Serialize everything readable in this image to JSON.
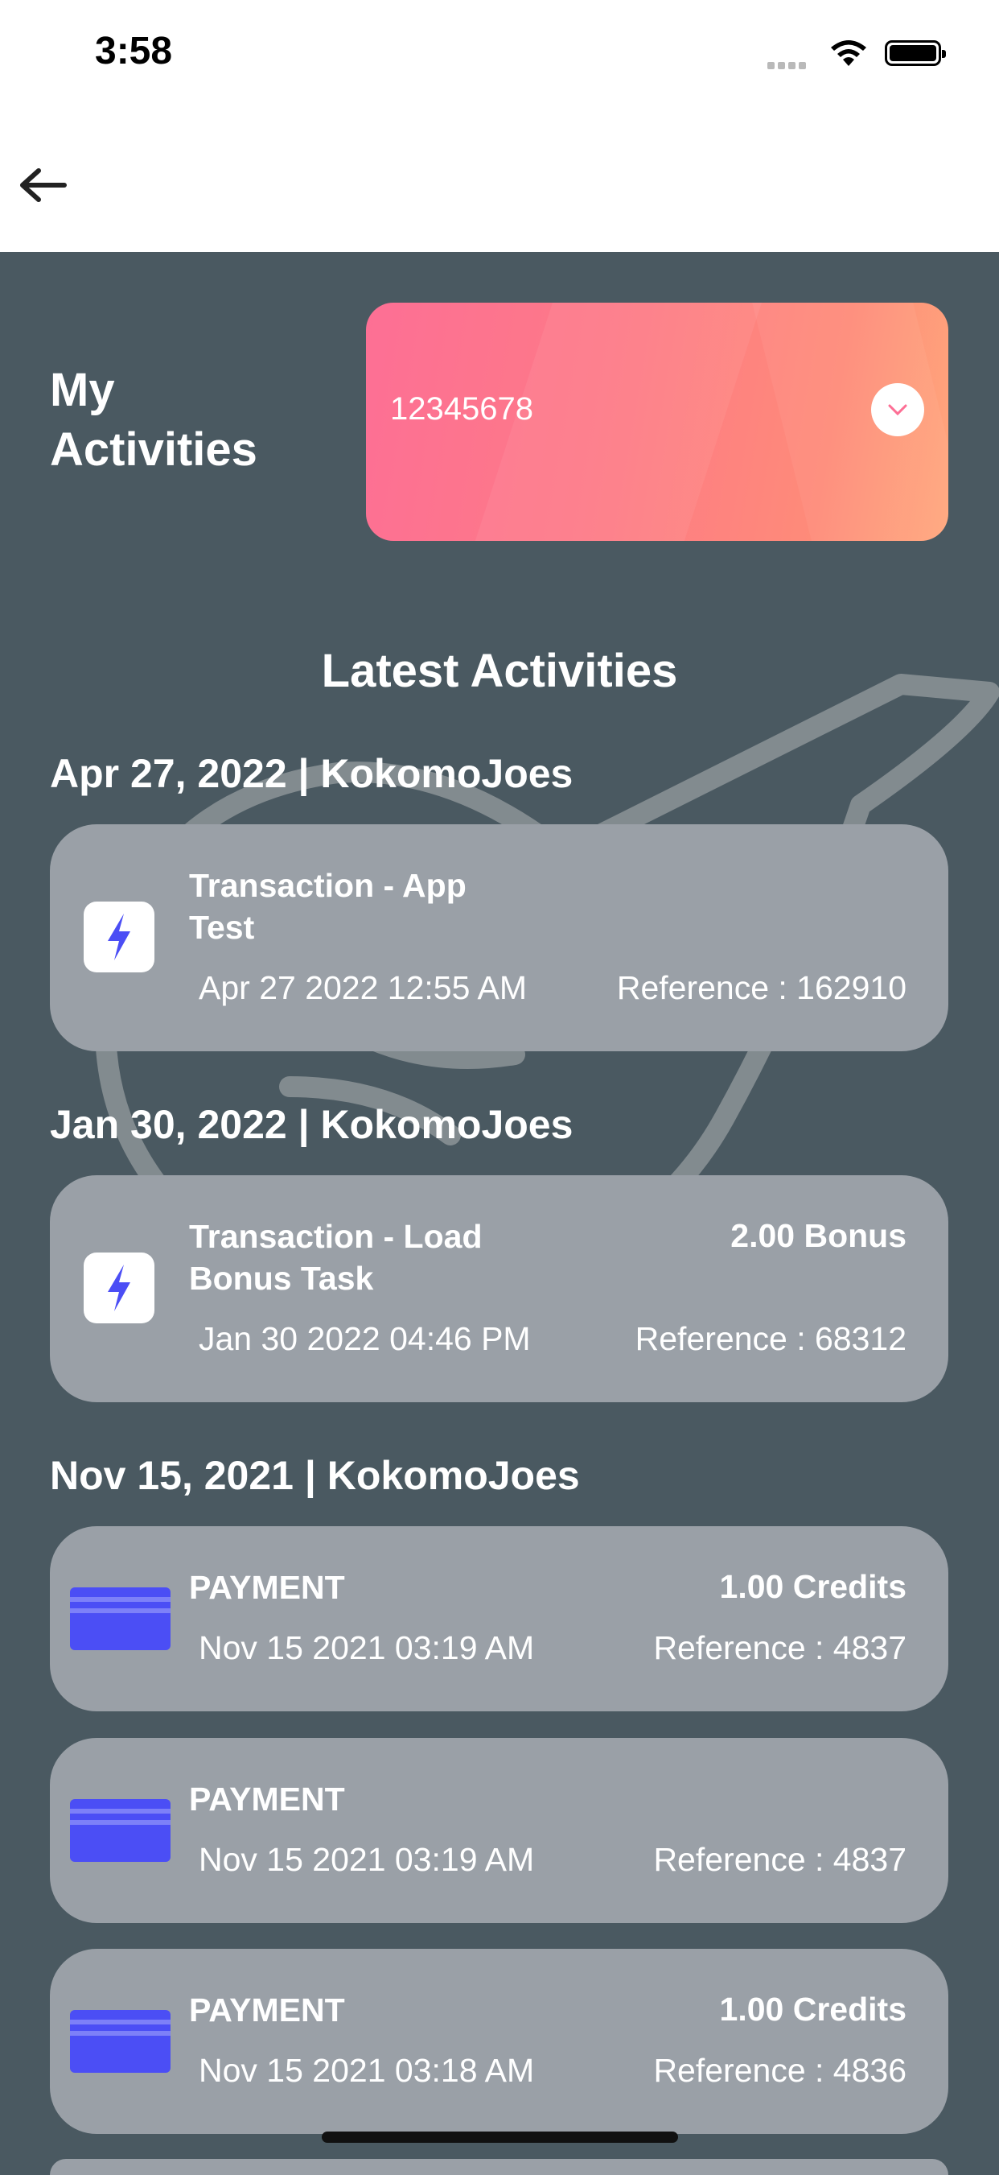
{
  "status_bar": {
    "time": "3:58",
    "signal_icon": "signal-dots-icon",
    "wifi_icon": "wifi-icon",
    "battery_icon": "battery-icon"
  },
  "nav": {
    "back_icon": "arrow-left-icon"
  },
  "header": {
    "title_line1": "My",
    "title_line2": "Activities"
  },
  "account_selector": {
    "number": "12345678",
    "dropdown_icon": "chevron-down-icon",
    "gradient_colors": [
      "#fd6f95",
      "#ffa77c"
    ]
  },
  "section_title": "Latest Activities",
  "groups": [
    {
      "header": "Apr 27, 2022 | KokomoJoes",
      "items": [
        {
          "icon": "lightning-bolt-icon",
          "title_line1": "Transaction - App",
          "title_line2": "Test",
          "amount": "",
          "time": "Apr 27 2022 12:55 AM",
          "reference": "Reference : 162910"
        }
      ]
    },
    {
      "header": "Jan 30, 2022 | KokomoJoes",
      "items": [
        {
          "icon": "lightning-bolt-icon",
          "title_line1": "Transaction - Load",
          "title_line2": "Bonus Task",
          "amount": "2.00 Bonus",
          "time": "Jan 30 2022 04:46 PM",
          "reference": "Reference : 68312"
        }
      ]
    },
    {
      "header": "Nov 15, 2021 | KokomoJoes",
      "items": [
        {
          "icon": "payment-card-icon",
          "title_line1": "PAYMENT",
          "amount": "1.00 Credits",
          "time": "Nov 15 2021 03:19 AM",
          "reference": "Reference : 4837"
        },
        {
          "icon": "payment-card-icon",
          "title_line1": "PAYMENT",
          "amount": "",
          "time": "Nov 15 2021 03:19 AM",
          "reference": "Reference : 4837"
        },
        {
          "icon": "payment-card-icon",
          "title_line1": "PAYMENT",
          "amount": "1.00 Credits",
          "time": "Nov 15 2021 03:18 AM",
          "reference": "Reference : 4836"
        }
      ]
    }
  ],
  "colors": {
    "background": "#4a5961",
    "card": "#9aa0a7",
    "accent_icon": "#4b4ef5"
  },
  "watermark_icon": "whale-watermark-icon"
}
